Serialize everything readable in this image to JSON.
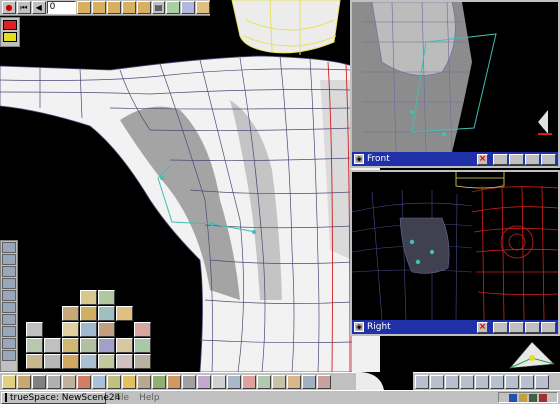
{
  "app": {
    "taskbar_title": "trueSpace: NewScene24",
    "menu": [
      "File",
      "Help"
    ]
  },
  "toolbar": {
    "frame_value": "0"
  },
  "viewports": {
    "front": {
      "label": "Front"
    },
    "right": {
      "label": "Right"
    }
  },
  "colors": {
    "background": "#000000",
    "panel": "#c0c0c0",
    "viewport_title_bar": "#2030a8",
    "mesh_white": "#f4f4f4",
    "mesh_shadow": "#9a9a9a",
    "wire_blue": "#4a4a78",
    "wire_red": "#d02020",
    "wire_yellow": "#e8e060",
    "selection_cyan": "#40c0b0"
  },
  "icons": {
    "viewport": "camera-icon",
    "close": "close-icon"
  }
}
